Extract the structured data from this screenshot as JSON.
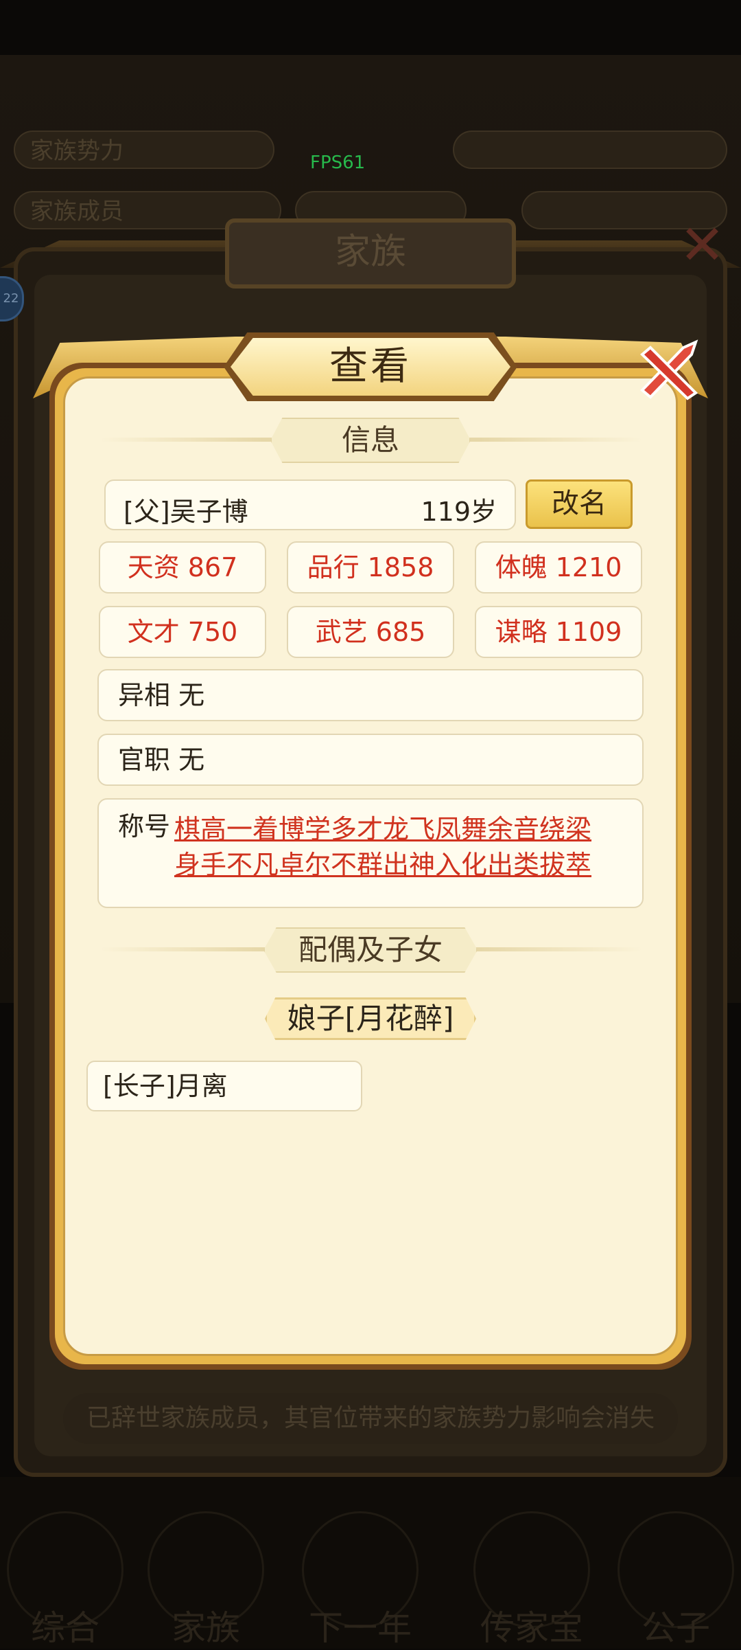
{
  "background": {
    "stat_labels": [
      "家族势力",
      "家族成员"
    ],
    "fps": "FPS61",
    "window_title": "家族",
    "badge": "22",
    "notice": "已辞世家族成员，其官位带来的家族势力影响会消失",
    "nav": [
      "综合",
      "家族",
      "下一年",
      "传家宝",
      "公子"
    ]
  },
  "modal": {
    "title": "查看",
    "section_info": "信息",
    "person": {
      "name": "[父]吴子博",
      "age": "119岁"
    },
    "rename_button": "改名",
    "stats": [
      {
        "label": "天资 867"
      },
      {
        "label": "品行 1858"
      },
      {
        "label": "体魄 1210"
      },
      {
        "label": "文才 750"
      },
      {
        "label": "武艺 685"
      },
      {
        "label": "谋略 1109"
      }
    ],
    "feature": "异相 无",
    "office": "官职 无",
    "titles_label": "称号",
    "titles_line1": "棋高一着博学多才龙飞凤舞余音绕梁",
    "titles_line2": "身手不凡卓尔不群出神入化出类拔萃",
    "section_family": "配偶及子女",
    "spouse": "娘子[月花醉]",
    "children": [
      "[长子]月离"
    ]
  },
  "colors": {
    "panel": "#fbf3d8",
    "gold": "#e8b64a",
    "stat_text": "#d1301e",
    "title_text": "#d0331f",
    "fps_text": "#27b94c"
  }
}
